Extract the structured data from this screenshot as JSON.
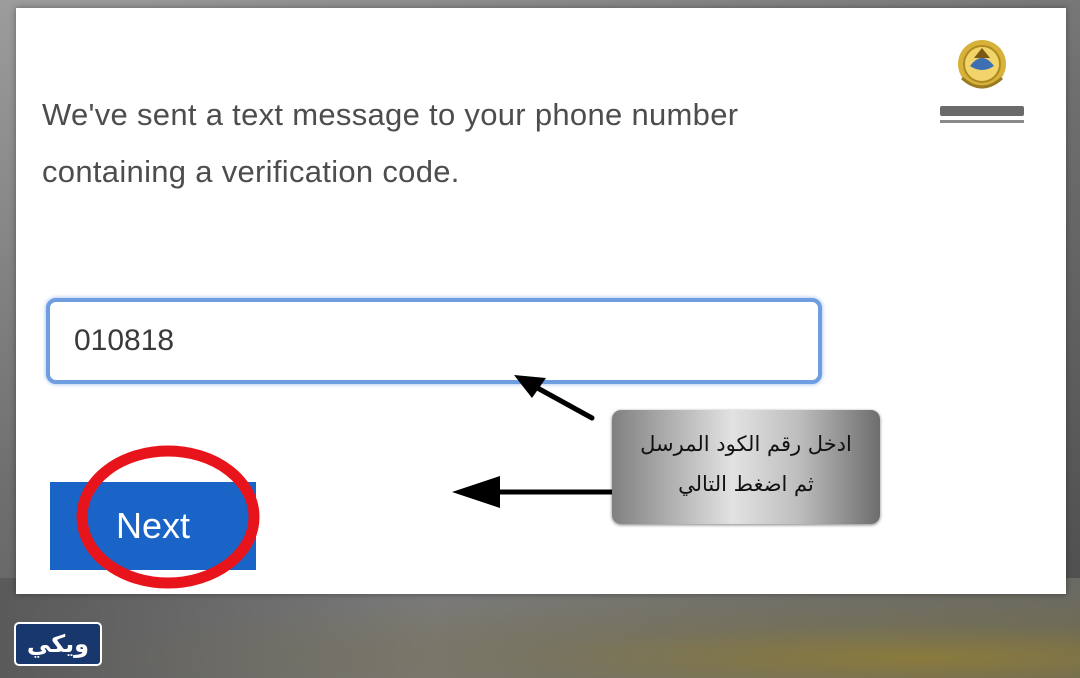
{
  "verification": {
    "message": "We've sent a text message to your phone number containing a verification code.",
    "code_value": "010818",
    "next_label": "Next"
  },
  "logo": {
    "icon": "kuwait-state-emblem-icon"
  },
  "annotation": {
    "line1": "ادخل رقم الكود المرسل",
    "line2": "ثم اضغط التالي",
    "highlight_color": "#e8141c",
    "arrow_color": "#000000"
  },
  "watermark": {
    "label": "ويكي"
  },
  "colors": {
    "primary_button": "#1a63c7",
    "input_focus_border": "#6e9ee0",
    "message_text": "#4d4d4d"
  }
}
